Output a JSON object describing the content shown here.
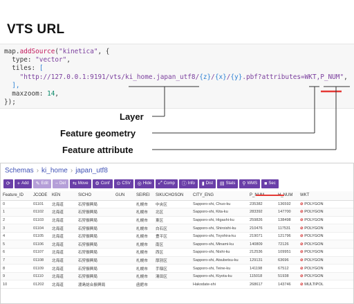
{
  "title": "VTS URL",
  "code": {
    "line1_pre": "map.",
    "line1_fn": "addSource",
    "line1_open": "(",
    "line1_str": "\"kinetica\"",
    "line1_post": ", {",
    "line2_key": "  type: ",
    "line2_str": "\"vector\"",
    "line2_post": ",",
    "line3_key": "  tiles: ",
    "line3_br": "[",
    "line4_str_a": "    \"http://127.0.0.1:9191/vts/ki_home.japan_utf8/",
    "line4_z": "{z}",
    "line4_slash1": "/",
    "line4_x": "{x}",
    "line4_slash2": "/",
    "line4_y": "{y}",
    "line4_str_b": ".pbf?attributes=WKT,P_NUM\"",
    "line4_post": ",",
    "line5": "  ],",
    "line6_key": "  maxzoom: ",
    "line6_num": "14",
    "line6_post": ",",
    "line7": "});"
  },
  "labels": {
    "layer": "Layer",
    "geometry": "Feature geometry",
    "attribute": "Feature attribute"
  },
  "colors": {
    "accent_red": "#e53935",
    "toolbar_purple": "#6a3fa8",
    "breadcrumb_blue": "#3f51b5"
  },
  "breadcrumb": {
    "schemas": "Schemas",
    "sep": "›",
    "schema": "ki_home",
    "table": "japan_utf8"
  },
  "toolbar": [
    {
      "icon": "refresh-icon",
      "glyph": "⟳",
      "label": ""
    },
    {
      "icon": "plus-icon",
      "glyph": "+",
      "label": "Add"
    },
    {
      "icon": "edit-icon",
      "glyph": "✎",
      "label": "Edit"
    },
    {
      "icon": "delete-icon",
      "glyph": "−",
      "label": "Del"
    },
    {
      "icon": "move-icon",
      "glyph": "⇆",
      "label": "Move"
    },
    {
      "icon": "conf-icon",
      "glyph": "⚙",
      "label": "Conf"
    },
    {
      "icon": "csv-icon",
      "glyph": "⊙",
      "label": "CSV"
    },
    {
      "icon": "hide-icon",
      "glyph": "◎",
      "label": "Hide"
    },
    {
      "icon": "comp-icon",
      "glyph": "⤢",
      "label": "Comp"
    },
    {
      "icon": "info-icon",
      "glyph": "ⓘ",
      "label": "Info"
    },
    {
      "icon": "dist-icon",
      "glyph": "▮",
      "label": "Dist"
    },
    {
      "icon": "stats-icon",
      "glyph": "▤",
      "label": "Stats"
    },
    {
      "icon": "wms-icon",
      "glyph": "⚲",
      "label": "WMS"
    },
    {
      "icon": "sec-icon",
      "glyph": "■",
      "label": "Sec"
    }
  ],
  "columns": [
    "Feature_ID",
    "JCODE",
    "KEN",
    "SICHO",
    "GUN",
    "SEIREI",
    "SIKUCHOSON",
    "CITY_ENG",
    "P_NUM",
    "H_NUM",
    "WKT"
  ],
  "rows": [
    [
      "0",
      "01101",
      "北海道",
      "石狩振興局",
      "",
      "札幌市",
      "中央区",
      "Sapporo-shi, Chuo-ku",
      "235382",
      "136592",
      "POLYGON"
    ],
    [
      "1",
      "01102",
      "北海道",
      "石狩振興局",
      "",
      "札幌市",
      "北区",
      "Sapporo-shi, Kita-ku",
      "283392",
      "147700",
      "POLYGON"
    ],
    [
      "2",
      "01103",
      "北海道",
      "石狩振興局",
      "",
      "札幌市",
      "東区",
      "Sapporo-shi, Higashi-ku",
      "259826",
      "138498",
      "POLYGON"
    ],
    [
      "3",
      "01104",
      "北海道",
      "石狩振興局",
      "",
      "札幌市",
      "白石区",
      "Sapporo-shi, Shiroishi-ku",
      "210476",
      "117531",
      "POLYGON"
    ],
    [
      "4",
      "01105",
      "北海道",
      "石狩振興局",
      "",
      "札幌市",
      "豊平区",
      "Sapporo-shi, Toyohira-ku",
      "219071",
      "121796",
      "POLYGON"
    ],
    [
      "5",
      "01106",
      "北海道",
      "石狩振興局",
      "",
      "札幌市",
      "南区",
      "Sapporo-shi, Minami-ku",
      "140809",
      "72126",
      "POLYGON"
    ],
    [
      "6",
      "01107",
      "北海道",
      "石狩振興局",
      "",
      "札幌市",
      "西区",
      "Sapporo-shi, Nishi-ku",
      "212536",
      "109951",
      "POLYGON"
    ],
    [
      "7",
      "01108",
      "北海道",
      "石狩振興局",
      "",
      "札幌市",
      "厚別区",
      "Sapporo-shi, Atsubetsu-ku",
      "129131",
      "63696",
      "POLYGON"
    ],
    [
      "8",
      "01109",
      "北海道",
      "石狩振興局",
      "",
      "札幌市",
      "手稲区",
      "Sapporo-shi, Teine-ku",
      "141198",
      "67512",
      "POLYGON"
    ],
    [
      "9",
      "01110",
      "北海道",
      "石狩振興局",
      "",
      "札幌市",
      "清田区",
      "Sapporo-shi, Kiyota-ku",
      "115018",
      "51938",
      "POLYGON"
    ],
    [
      "10",
      "01202",
      "北海道",
      "渡島総合振興局",
      "",
      "函館市",
      "",
      "Hakodate-shi",
      "268617",
      "143746",
      "MULTIPOL"
    ]
  ]
}
